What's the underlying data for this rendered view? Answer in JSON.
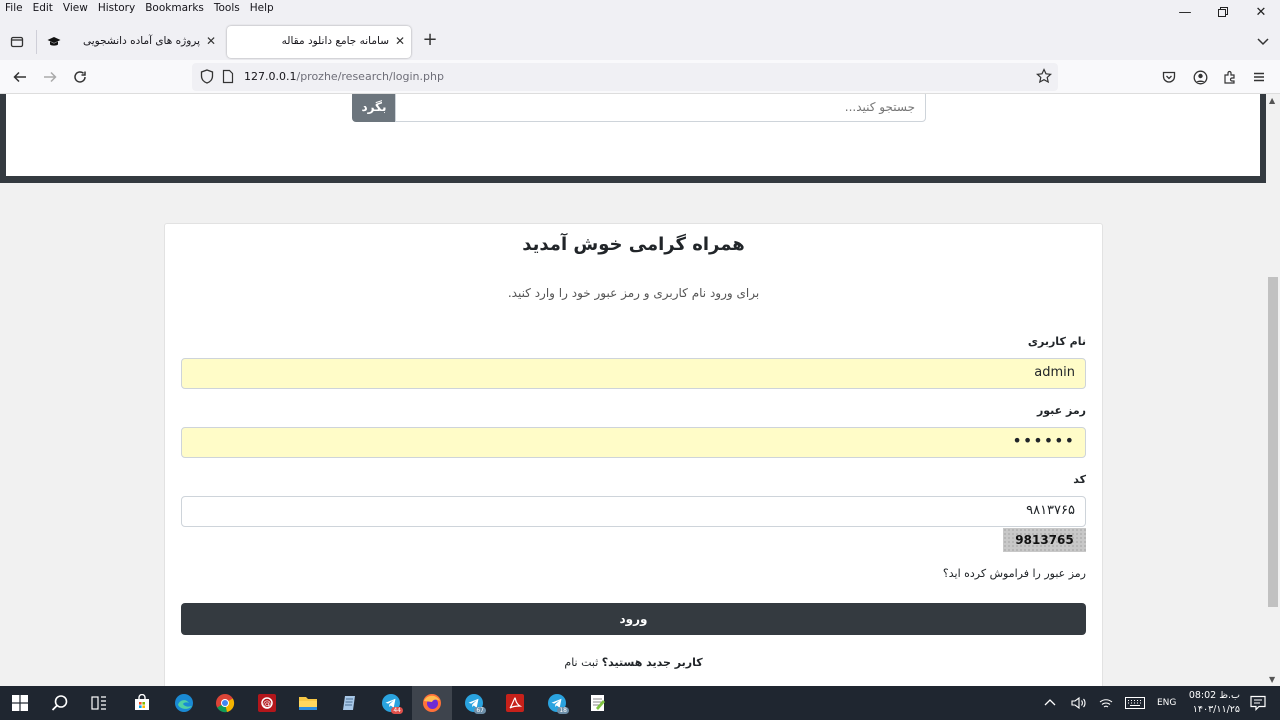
{
  "menu": [
    "File",
    "Edit",
    "View",
    "History",
    "Bookmarks",
    "Tools",
    "Help"
  ],
  "tabs": [
    {
      "title": "پروژه های آماده دانشجویی",
      "active": false
    },
    {
      "title": "سامانه جامع دانلود مقاله",
      "active": true
    }
  ],
  "url": {
    "host": "127.0.0.1",
    "path": "/prozhe/research/login.php"
  },
  "header": {
    "search_placeholder": "جستجو کنید...",
    "search_button": "بگرد"
  },
  "login": {
    "title": "همراه گرامی خوش آمدید",
    "subtitle": "برای ورود نام کاربری و رمز عبور خود را وارد کنید.",
    "username_label": "نام کاربری",
    "username_value": "admin",
    "password_label": "رمز عبور",
    "password_value": "••••••",
    "code_label": "کد",
    "code_value": "۹۸۱۳۷۶۵",
    "captcha_text": "9813765",
    "forgot_link": "رمز عبور را فراموش کرده اید؟",
    "submit_label": "ورود",
    "register_question": "کاربر جدید هستید؟",
    "register_link": "ثبت نام"
  },
  "taskbar": {
    "badges": {
      "telegram1": "44",
      "telegram2": "67",
      "telegram3": "18"
    },
    "lang": "ENG",
    "time": "08:02 ب.ظ",
    "date": "۱۴۰۳/۱۱/۲۵"
  },
  "colors": {
    "dark": "#343a40",
    "autofill": "#fffcc8",
    "search_btn": "#6c757d",
    "taskbar": "#1f2630"
  }
}
